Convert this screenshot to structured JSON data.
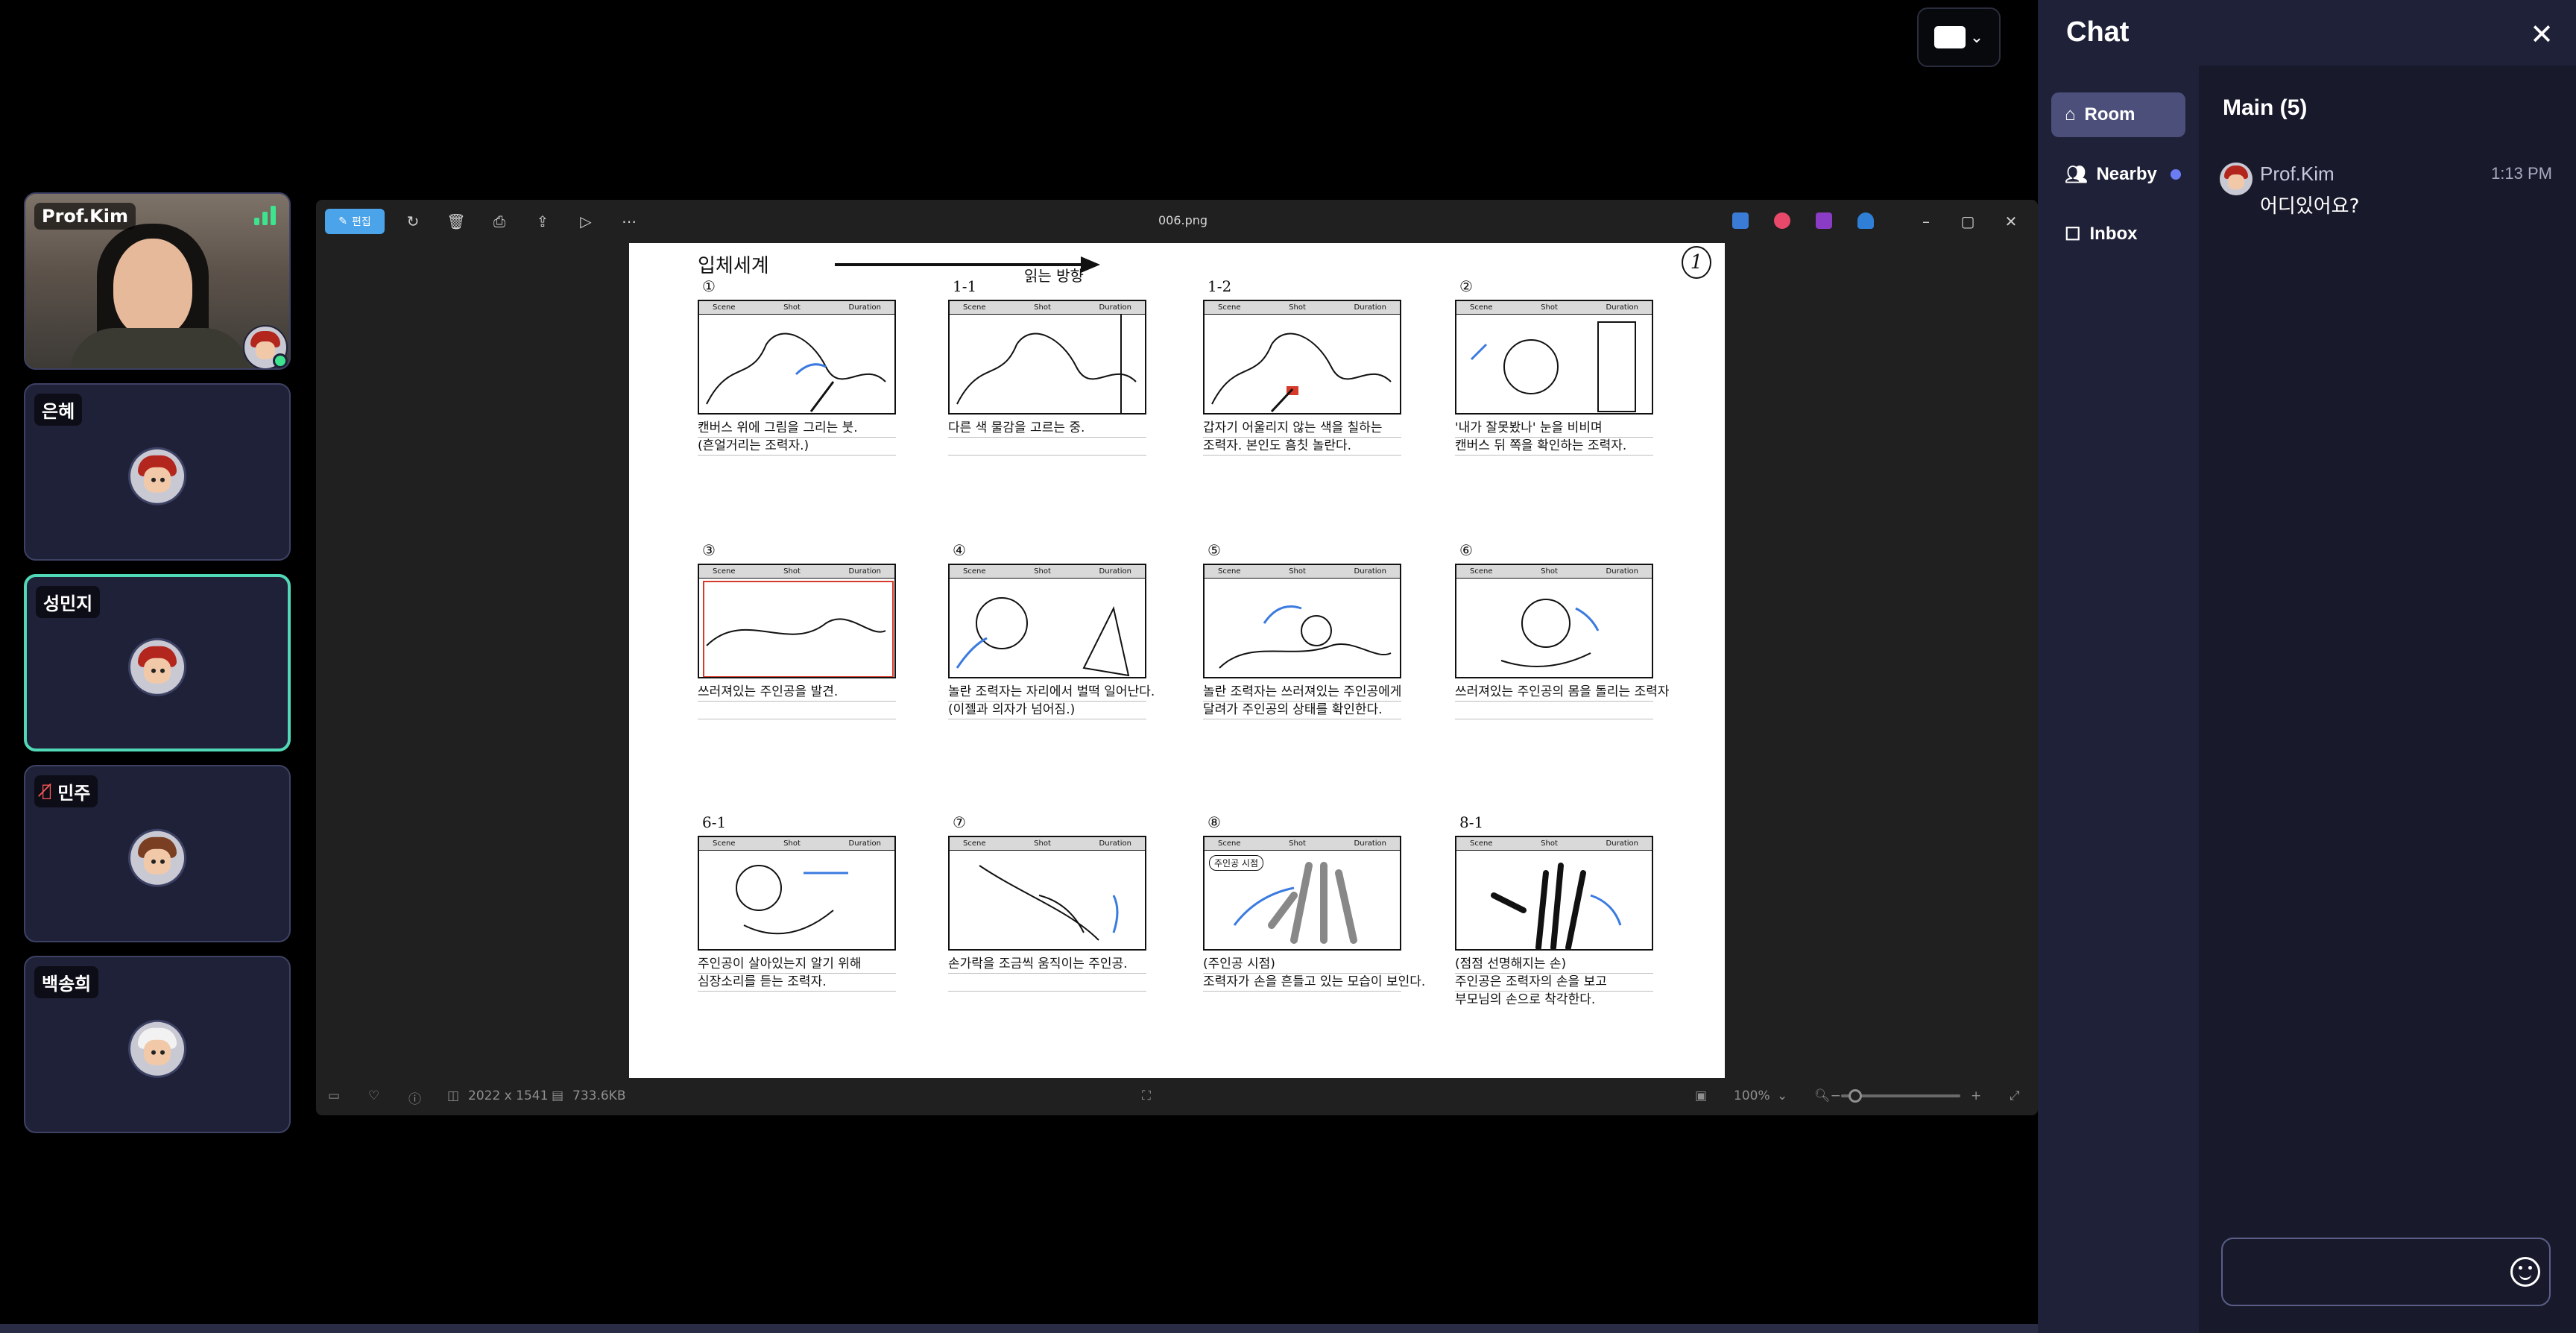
{
  "participants": [
    {
      "name": "Prof.Kim",
      "video": true
    },
    {
      "name": "은혜"
    },
    {
      "name": "성민지",
      "active": true
    },
    {
      "name": "민주",
      "muted": true
    },
    {
      "name": "백송희"
    }
  ],
  "viewer": {
    "edit_label": "편집",
    "filename": "006.png",
    "dimensions": "2022 x 1541",
    "filesize": "733.6KB",
    "zoom": "100%",
    "zoom_level": 0.12
  },
  "storyboard": {
    "title": "입체세계",
    "direction_label": "읽는 방향",
    "page_number": "1",
    "frame_header": {
      "scene": "Scene",
      "shot": "Shot",
      "duration": "Duration"
    },
    "panels": [
      {
        "label": "①",
        "caption_1": "캔버스 위에 그림을 그리는 붓.",
        "caption_2": "(흔얼거리는 조력자.)"
      },
      {
        "label": "1-1",
        "caption_1": "다른 색 물감을 고르는 중.",
        "caption_2": ""
      },
      {
        "label": "1-2",
        "caption_1": "갑자기 어울리지 않는 색을 칠하는",
        "caption_2": "조력자. 본인도 흠칫 놀란다."
      },
      {
        "label": "②",
        "caption_1": "'내가 잘못봤나' 눈을 비비며",
        "caption_2": "캔버스 뒤 쪽을 확인하는 조력자."
      },
      {
        "label": "③",
        "caption_1": "쓰러져있는 주인공을 발견.",
        "caption_2": ""
      },
      {
        "label": "④",
        "caption_1": "놀란 조력자는 자리에서 벌떡 일어난다.",
        "caption_2": "(이젤과 의자가 넘어짐.)"
      },
      {
        "label": "⑤",
        "caption_1": "놀란 조력자는 쓰러져있는 주인공에게",
        "caption_2": "달려가 주인공의 상태를 확인한다."
      },
      {
        "label": "⑥",
        "caption_1": "쓰러져있는 주인공의 몸을 돌리는 조력자",
        "caption_2": ""
      },
      {
        "label": "6-1",
        "caption_1": "주인공이 살아있는지 알기 위해",
        "caption_2": "심장소리를 듣는 조력자."
      },
      {
        "label": "⑦",
        "caption_1": "손가락을 조금씩 움직이는 주인공.",
        "caption_2": ""
      },
      {
        "label": "⑧",
        "caption_1": "(주인공 시점)",
        "caption_2": "조력자가 손을 흔들고 있는 모습이 보인다.",
        "note": "주인공 시점"
      },
      {
        "label": "8-1",
        "caption_1": "(점점 선명해지는 손)",
        "caption_2": "주인공은 조력자의 손을 보고",
        "caption_3": "부모님의 손으로 착각한다."
      }
    ]
  },
  "chat": {
    "title": "Chat",
    "nav": [
      {
        "label": "Room",
        "icon": "room-icon"
      },
      {
        "label": "Nearby",
        "icon": "people-icon",
        "unread": true
      },
      {
        "label": "Inbox",
        "icon": "inbox-icon"
      }
    ],
    "channel": "Main (5)",
    "messages": [
      {
        "sender": "Prof.Kim",
        "time": "1:13 PM",
        "text": "어디있어요?"
      }
    ],
    "input_placeholder": ""
  },
  "colors": {
    "accent": "#51d9b7",
    "tile_bg": "#1f2138",
    "edit_button": "#4ba3ea",
    "unread": "#6c7cf5",
    "mic_muted": "#ff5a5a"
  }
}
